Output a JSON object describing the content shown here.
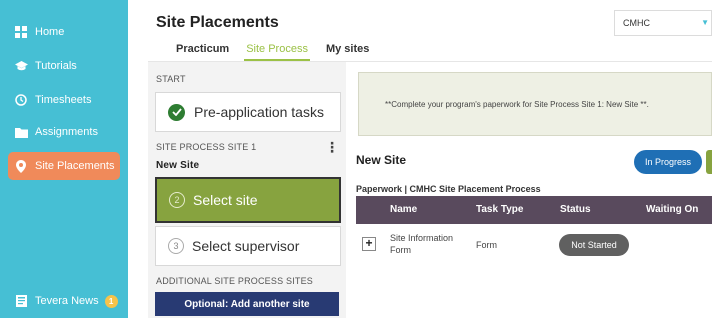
{
  "sidebar": {
    "items": [
      {
        "label": "Home",
        "icon": "grid-icon"
      },
      {
        "label": "Tutorials",
        "icon": "mortarboard-icon"
      },
      {
        "label": "Timesheets",
        "icon": "clock-icon"
      },
      {
        "label": "Assignments",
        "icon": "folder-icon"
      },
      {
        "label": "Site Placements",
        "icon": "map-pin-icon",
        "active": true
      }
    ],
    "news": {
      "label": "Tevera News",
      "badge": "1"
    },
    "colors": {
      "background": "#46bfd4",
      "active": "#f08a5a"
    }
  },
  "header": {
    "title": "Site Placements",
    "tabs": [
      "Practicum",
      "Site Process",
      "My sites"
    ],
    "active_tab": "Site Process",
    "org_select": {
      "value": "CMHC"
    }
  },
  "left": {
    "start_label": "START",
    "pre_app": "Pre-application tasks",
    "site_section_label": "SITE PROCESS SITE 1",
    "site_name": "New Site",
    "steps": [
      {
        "num": "2",
        "label": "Select site",
        "current": true
      },
      {
        "num": "3",
        "label": "Select supervisor",
        "current": false
      }
    ],
    "additional_label": "ADDITIONAL SITE PROCESS SITES",
    "add_button": "Optional: Add another site"
  },
  "right": {
    "notice": "**Complete your program's paperwork for Site Process Site 1: New Site **.",
    "site_title": "New Site",
    "status": "In Progress",
    "paperwork_label": "Paperwork | CMHC Site Placement Process",
    "table": {
      "headers": [
        "Name",
        "Task Type",
        "Status",
        "Waiting On"
      ],
      "rows": [
        {
          "name": "Site Information Form",
          "type": "Form",
          "status": "Not Started",
          "waiting": ""
        }
      ]
    },
    "colors": {
      "table_header": "#594a5d",
      "status_pill": "#1f6fb5",
      "current_step": "#87a33f"
    }
  }
}
